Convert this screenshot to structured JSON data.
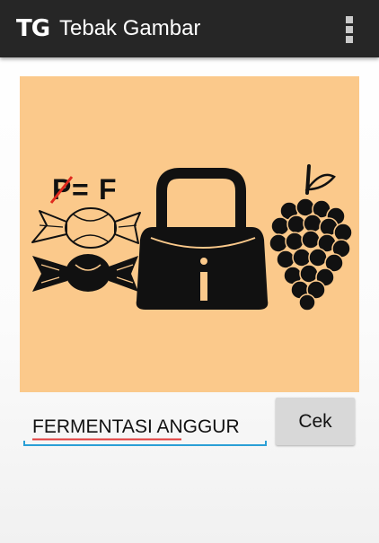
{
  "action_bar": {
    "logo_text": "TG",
    "title": "Tebak Gambar",
    "menu_icon": "overflow-menu-icon",
    "background": "#262626"
  },
  "puzzle": {
    "background": "#fbc98b",
    "letter_rule": {
      "from": "P",
      "equals": "=",
      "to": "F"
    },
    "icons": [
      "candy-outline-icon",
      "candy-filled-icon",
      "handbag-icon",
      "grapes-icon"
    ]
  },
  "answer": {
    "value": "FERMENTASI ANGGUR",
    "accent": "#2a9fd6",
    "spellcheck_color": "#e03a3a"
  },
  "check_button": {
    "label": "Cek"
  }
}
